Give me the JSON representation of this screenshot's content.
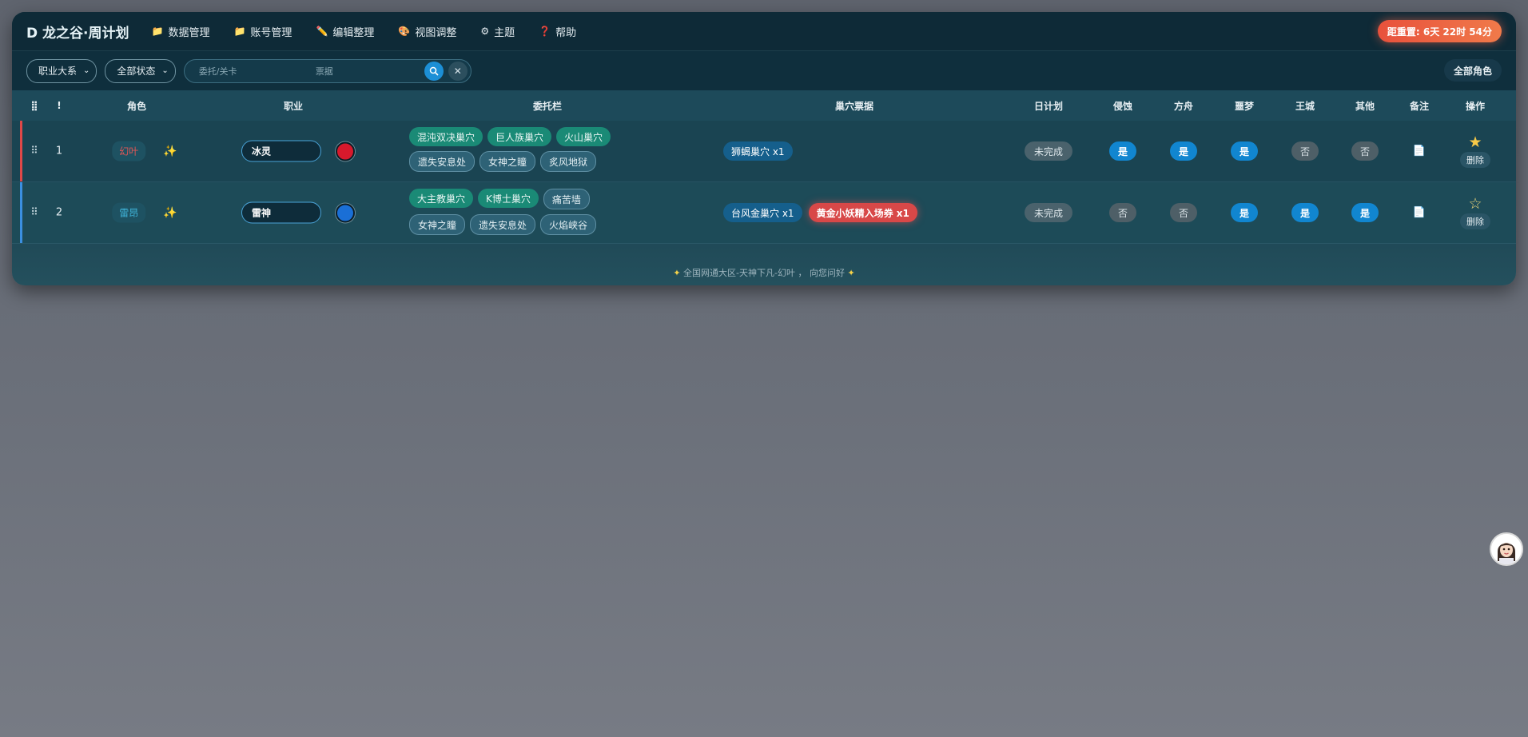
{
  "header": {
    "brand": "D 龙之谷·周计划",
    "menu": [
      {
        "icon": "📁",
        "label": "数据管理"
      },
      {
        "icon": "📁",
        "label": "账号管理"
      },
      {
        "icon": "✏️",
        "label": "编辑整理"
      },
      {
        "icon": "🎨",
        "label": "视图调整"
      },
      {
        "icon": "⚙",
        "label": "主题"
      },
      {
        "icon": "❓",
        "label": "帮助"
      }
    ],
    "countdown": "距重置: 6天 22时 54分"
  },
  "toolbar": {
    "class_filter": "职业大系",
    "status_filter": "全部状态",
    "search_placeholder_task": "委托/关卡",
    "search_placeholder_ticket": "票据",
    "all_roles": "全部角色"
  },
  "table": {
    "headers": {
      "drag": "⣿",
      "flag": "!",
      "role": "角色",
      "job": "职业",
      "tasks": "委托栏",
      "tickets": "巢穴票据",
      "daily": "日计划",
      "invade": "侵蚀",
      "ark": "方舟",
      "nightmare": "噩梦",
      "royal": "王城",
      "other": "其他",
      "note": "备注",
      "ops": "操作"
    },
    "rows": [
      {
        "index": "1",
        "role": "幻叶",
        "role_color": "#e05656",
        "accent": "#e04848",
        "job": "冰灵",
        "job_color": "#d7192c",
        "tasks": [
          {
            "label": "混沌双决巢穴",
            "style": "green"
          },
          {
            "label": "巨人族巢穴",
            "style": "green"
          },
          {
            "label": "火山巢穴",
            "style": "green"
          },
          {
            "label": "遗失安息处",
            "style": "outline"
          },
          {
            "label": "女神之瞳",
            "style": "outline"
          },
          {
            "label": "炙风地狱",
            "style": "outline"
          }
        ],
        "tickets": [
          {
            "label": "狮蝎巢穴 x1",
            "style": "blue"
          }
        ],
        "daily": "未完成",
        "invade": "是",
        "ark": "是",
        "nightmare": "是",
        "royal": "否",
        "other": "否",
        "starred": true,
        "delete_label": "删除"
      },
      {
        "index": "2",
        "role": "雷昂",
        "role_color": "#3fb3d8",
        "accent": "#3b8fe0",
        "job": "雷神",
        "job_color": "#1a6fd6",
        "tasks": [
          {
            "label": "大主教巢穴",
            "style": "green"
          },
          {
            "label": "K博士巢穴",
            "style": "green"
          },
          {
            "label": "痛苦墙",
            "style": "outline"
          },
          {
            "label": "女神之瞳",
            "style": "outline"
          },
          {
            "label": "遗失安息处",
            "style": "outline"
          },
          {
            "label": "火焰峡谷",
            "style": "outline"
          }
        ],
        "tickets": [
          {
            "label": "台风金巢穴 x1",
            "style": "blue"
          },
          {
            "label": "黄金小妖精入场券 x1",
            "style": "red"
          }
        ],
        "daily": "未完成",
        "invade": "否",
        "ark": "否",
        "nightmare": "是",
        "royal": "是",
        "other": "是",
        "starred": false,
        "delete_label": "删除"
      }
    ]
  },
  "footer": {
    "text": "全国网通大区-天神下凡-幻叶 ， 向您问好"
  }
}
